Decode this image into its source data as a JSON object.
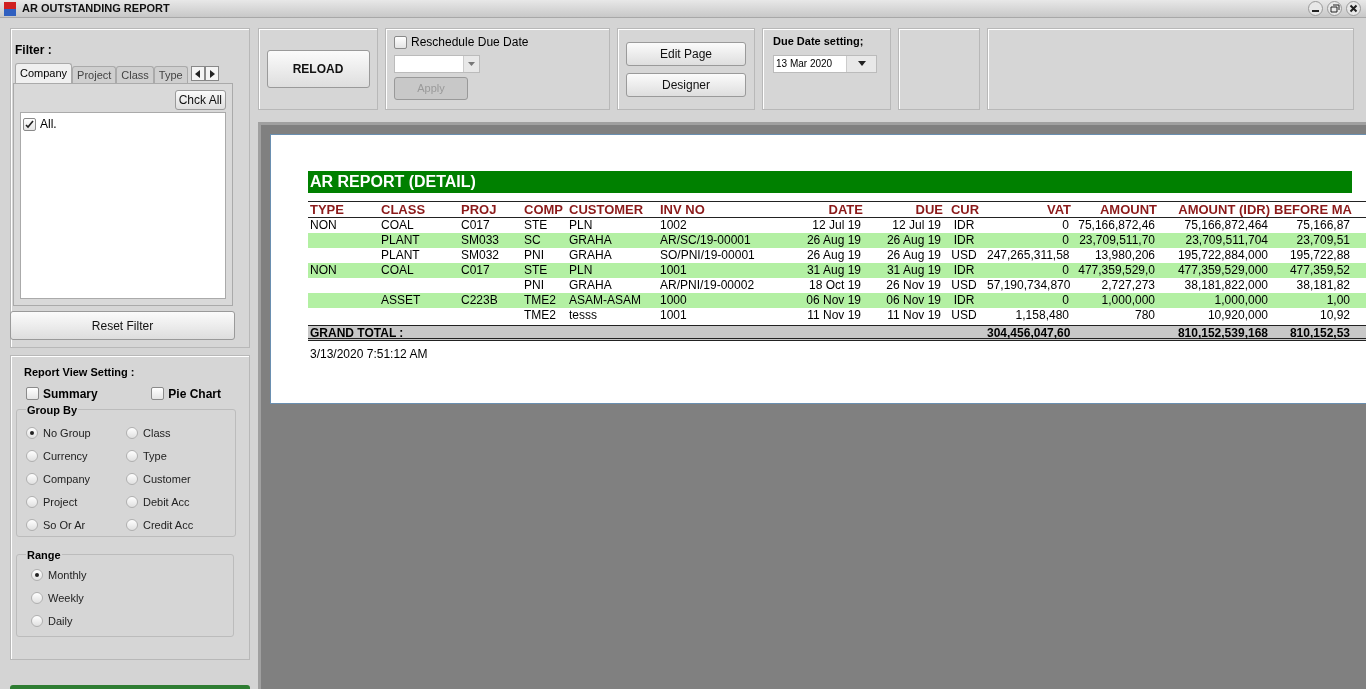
{
  "window": {
    "title": "AR OUTSTANDING REPORT"
  },
  "filter": {
    "label": "Filter :",
    "tabs": [
      {
        "label": "Company",
        "selected": true
      },
      {
        "label": "Project",
        "selected": false
      },
      {
        "label": "Class",
        "selected": false
      },
      {
        "label": "Type",
        "selected": false
      }
    ],
    "check_all_button": "Chck All",
    "items": [
      {
        "label": "All.",
        "checked": true
      }
    ],
    "reset_button": "Reset Filter"
  },
  "toolbar": {
    "reload_button": "RELOAD",
    "reschedule": {
      "label": "Reschedule Due Date",
      "checked": false
    },
    "apply_button": {
      "label": "Apply",
      "disabled": true
    },
    "edit_page_button": "Edit Page",
    "designer_button": "Designer",
    "due_date": {
      "label": "Due Date setting;",
      "value": "13 Mar 2020"
    }
  },
  "report_view": {
    "title": "Report View Setting :",
    "options": [
      {
        "label": "Summary",
        "checked": false
      },
      {
        "label": "Pie Chart",
        "checked": false
      }
    ],
    "group_by": {
      "title": "Group By",
      "options": [
        {
          "label": "No Group",
          "selected": true
        },
        {
          "label": "Class",
          "selected": false
        },
        {
          "label": "Currency",
          "selected": false
        },
        {
          "label": "Type",
          "selected": false
        },
        {
          "label": "Company",
          "selected": false
        },
        {
          "label": "Customer",
          "selected": false
        },
        {
          "label": "Project",
          "selected": false
        },
        {
          "label": "Debit Acc",
          "selected": false
        },
        {
          "label": "So Or Ar",
          "selected": false
        },
        {
          "label": "Credit Acc",
          "selected": false
        }
      ]
    },
    "range": {
      "title": "Range",
      "options": [
        {
          "label": "Monthly",
          "selected": true
        },
        {
          "label": "Weekly",
          "selected": false
        },
        {
          "label": "Daily",
          "selected": false
        }
      ]
    }
  },
  "report": {
    "title": "AR REPORT (DETAIL)",
    "columns": [
      "TYPE",
      "CLASS",
      "PROJ",
      "COMP",
      "CUSTOMER",
      "INV NO",
      "DATE",
      "DUE",
      "CUR",
      "VAT",
      "AMOUNT",
      "AMOUNT (IDR)",
      "BEFORE MA"
    ],
    "rows": [
      [
        "NON",
        "COAL",
        "C017",
        "STE",
        "PLN",
        "1002",
        "12 Jul 19",
        "12 Jul 19",
        "IDR",
        "0",
        "75,166,872,46",
        "75,166,872,464",
        "75,166,87"
      ],
      [
        null,
        "PLANT",
        "SM033",
        "SC",
        "GRAHA",
        "AR/SC/19-00001",
        "26 Aug 19",
        "26 Aug 19",
        "IDR",
        "0",
        "23,709,511,70",
        "23,709,511,704",
        "23,709,51"
      ],
      [
        null,
        "PLANT",
        "SM032",
        "PNI",
        "GRAHA",
        "SO/PNI/19-00001",
        "26 Aug 19",
        "26 Aug 19",
        "USD",
        "247,265,311,58",
        "13,980,206",
        "195,722,884,000",
        "195,722,88"
      ],
      [
        "NON",
        "COAL",
        "C017",
        "STE",
        "PLN",
        "1001",
        "31 Aug 19",
        "31 Aug 19",
        "IDR",
        "0",
        "477,359,529,0",
        "477,359,529,000",
        "477,359,52"
      ],
      [
        null,
        null,
        null,
        "PNI",
        "GRAHA",
        "AR/PNI/19-00002",
        "18 Oct 19",
        "26 Nov 19",
        "USD",
        "57,190,734,870",
        "2,727,273",
        "38,181,822,000",
        "38,181,82"
      ],
      [
        null,
        "ASSET",
        "C223B",
        "TME2",
        "ASAM-ASAM",
        "1000",
        "06 Nov 19",
        "06 Nov 19",
        "IDR",
        "0",
        "1,000,000",
        "1,000,000",
        "1,00"
      ],
      [
        null,
        null,
        null,
        "TME2",
        "tesss",
        "1001",
        "11 Nov 19",
        "11 Nov 19",
        "USD",
        "1,158,480",
        "780",
        "10,920,000",
        "10,92"
      ]
    ],
    "grand_total": {
      "label": "GRAND TOTAL :",
      "vat": "304,456,047,60",
      "amount_idr": "810,152,539,168",
      "before_ma": "810,152,53"
    },
    "timestamp": "3/13/2020 7:51:12 AM"
  }
}
